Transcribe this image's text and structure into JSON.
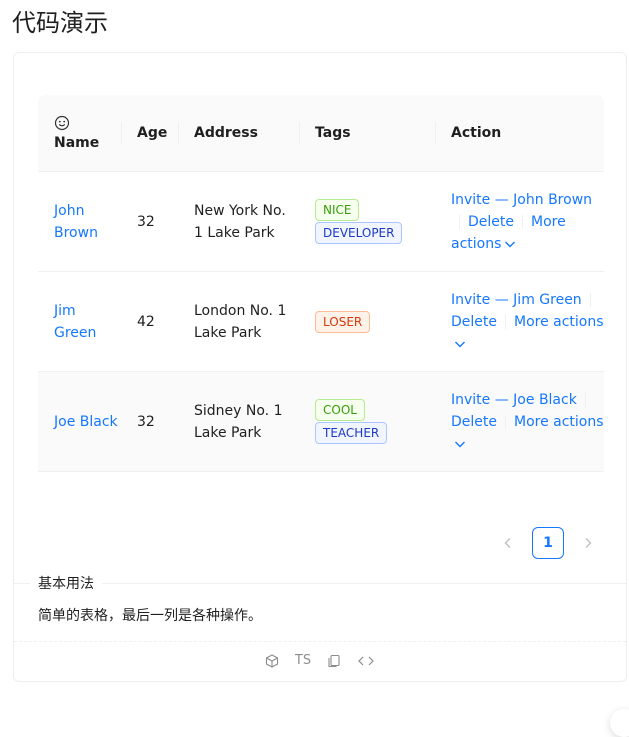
{
  "page": {
    "title": "代码演示"
  },
  "table": {
    "columns": [
      "Name",
      "Age",
      "Address",
      "Tags",
      "Action"
    ],
    "rows": [
      {
        "name": "John Brown",
        "age": "32",
        "address": "New York No. 1 Lake Park",
        "tags": [
          "NICE",
          "DEVELOPER"
        ],
        "actions": {
          "invite": "Invite — John Brown",
          "delete": "Delete",
          "more": "More actions"
        }
      },
      {
        "name": "Jim Green",
        "age": "42",
        "address": "London No. 1 Lake Park",
        "tags": [
          "LOSER"
        ],
        "actions": {
          "invite": "Invite — Jim Green",
          "delete": "Delete",
          "more": "More actions"
        }
      },
      {
        "name": "Joe Black",
        "age": "32",
        "address": "Sidney No. 1 Lake Park",
        "tags": [
          "COOL",
          "TEACHER"
        ],
        "actions": {
          "invite": "Invite — Joe Black",
          "delete": "Delete",
          "more": "More actions"
        }
      }
    ]
  },
  "pagination": {
    "current": "1",
    "prev_icon": "chevron-left-icon",
    "next_icon": "chevron-right-icon"
  },
  "meta": {
    "title": "基本用法",
    "description": "简单的表格，最后一列是各种操作。"
  },
  "code_actions": {
    "ts_label": "TS",
    "icons": [
      "codesandbox-icon",
      "copy-icon",
      "code-expand-icon"
    ]
  },
  "colors": {
    "link": "#1677ff",
    "green": "#389e0d",
    "geekblue": "#1d39c4",
    "volcano": "#d4380d"
  }
}
